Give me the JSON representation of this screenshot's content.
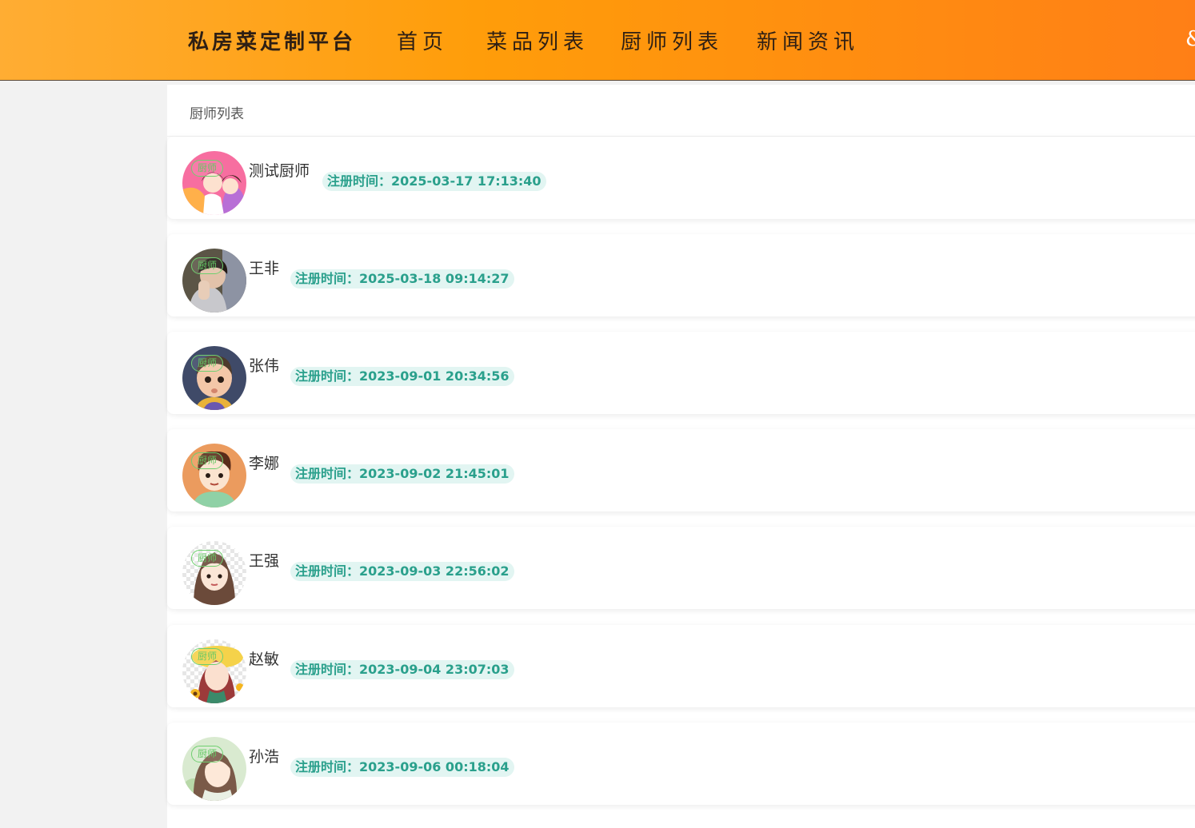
{
  "header": {
    "brand": "私房菜定制平台",
    "nav": [
      "首页",
      "菜品列表",
      "厨师列表",
      "新闻资讯"
    ],
    "edge_glyph": "&"
  },
  "panel": {
    "title": "厨师列表"
  },
  "chef_tag_label": "厨师",
  "chefs": [
    {
      "name": "测试厨师",
      "reg_label": "注册时间：",
      "reg_time": "2025-03-17 17:13:40",
      "avatar": "pink-couple-avatar"
    },
    {
      "name": "王非",
      "reg_label": "注册时间：",
      "reg_time": "2025-03-18 09:14:27",
      "avatar": "photo-boy-avatar"
    },
    {
      "name": "张伟",
      "reg_label": "注册时间：",
      "reg_time": "2023-09-01 20:34:56",
      "avatar": "cartoon-boy-navy-avatar"
    },
    {
      "name": "李娜",
      "reg_label": "注册时间：",
      "reg_time": "2023-09-02 21:45:01",
      "avatar": "cartoon-boy-orange-avatar"
    },
    {
      "name": "王强",
      "reg_label": "注册时间：",
      "reg_time": "2023-09-03 22:56:02",
      "avatar": "cartoon-girl-checker-avatar"
    },
    {
      "name": "赵敏",
      "reg_label": "注册时间：",
      "reg_time": "2023-09-04 23:07:03",
      "avatar": "sunflower-girl-avatar"
    },
    {
      "name": "孙浩",
      "reg_label": "注册时间：",
      "reg_time": "2023-09-06 00:18:04",
      "avatar": "watercolor-girl-avatar"
    }
  ]
}
